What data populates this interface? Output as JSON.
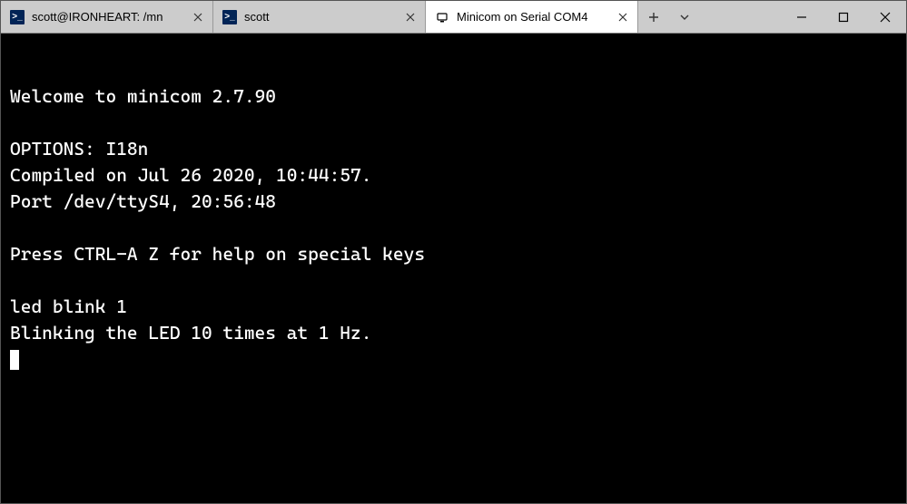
{
  "tabs": [
    {
      "label": "scott@IRONHEART: /mn",
      "icon": "powershell",
      "active": false
    },
    {
      "label": "scott",
      "icon": "powershell",
      "active": false
    },
    {
      "label": "Minicom on Serial COM4",
      "icon": "minicom",
      "active": true
    }
  ],
  "terminal": {
    "lines": [
      "Welcome to minicom 2.7.90",
      "",
      "OPTIONS: I18n",
      "Compiled on Jul 26 2020, 10:44:57.",
      "Port /dev/ttyS4, 20:56:48",
      "",
      "Press CTRL-A Z for help on special keys",
      "",
      "led blink 1",
      "Blinking the LED 10 times at 1 Hz."
    ]
  },
  "icons": {
    "close": "✕",
    "plus": "＋",
    "chevron": "⌄",
    "minimize": "—",
    "maximize": "☐"
  }
}
